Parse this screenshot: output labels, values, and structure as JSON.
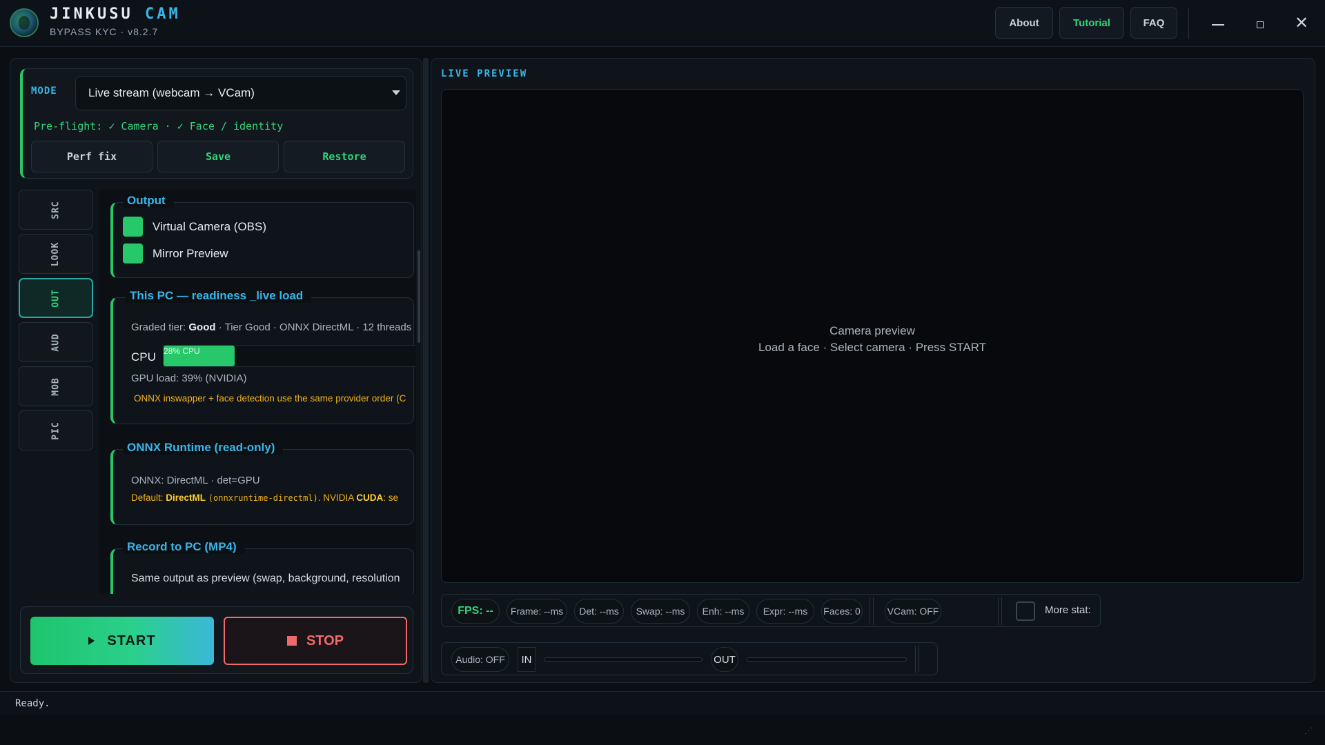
{
  "app": {
    "title_main": "JINKUSU",
    "title_accent": "CAM",
    "subtitle": "BYPASS KYC · v8.2.7"
  },
  "header": {
    "about": "About",
    "tutorial": "Tutorial",
    "faq": "FAQ",
    "close_glyph": "✕"
  },
  "mode": {
    "label": "MODE",
    "selected": "Live stream (webcam → VCam)",
    "preflight": "Pre-flight: ✓ Camera · ✓ Face / identity",
    "perf_fix": "Perf fix",
    "save": "Save",
    "restore": "Restore"
  },
  "side_tabs": [
    "SRC",
    "LOOK",
    "OUT",
    "AUD",
    "MOB",
    "PIC"
  ],
  "active_tab": "OUT",
  "output": {
    "title": "Output",
    "virtual_camera": "Virtual Camera (OBS)",
    "mirror_preview": "Mirror Preview"
  },
  "readiness": {
    "title": "This PC — readiness _live load",
    "tier_prefix": "Graded tier: ",
    "tier_value": "Good",
    "tier_suffix": " · Tier Good · ONNX DirectML · 12 threads",
    "cpu_label": "CPU",
    "cpu_text": "28% CPU",
    "cpu_percent": 28,
    "gpu_load": "GPU load: 39% (NVIDIA)",
    "warning": "ONNX inswapper + face detection use the same provider order (C"
  },
  "onnx": {
    "title": "ONNX Runtime (read-only)",
    "status": "ONNX: DirectML · det=GPU",
    "default_prefix": "Default: ",
    "default_provider": "DirectML",
    "package": "(onnxruntime-directml)",
    "nvidia_text": ". NVIDIA ",
    "cuda": "CUDA",
    "tail": ": se"
  },
  "record": {
    "title": "Record to PC (MP4)",
    "desc": "Same output as preview (swap, background, resolution"
  },
  "actions": {
    "start": "START",
    "stop": "STOP"
  },
  "preview": {
    "label": "LIVE PREVIEW",
    "title": "Camera preview",
    "hint": "Load a face  ·  Select camera  ·  Press START"
  },
  "stats": {
    "fps": "FPS: --",
    "frame": "Frame: --ms",
    "det": "Det: --ms",
    "swap": "Swap: --ms",
    "enh": "Enh: --ms",
    "expr": "Expr: --ms",
    "faces": "Faces: 0",
    "vcam": "VCam: OFF",
    "more": "More stat:"
  },
  "audio": {
    "status": "Audio: OFF",
    "in": "IN",
    "out": "OUT"
  },
  "status_bar": {
    "text": "Ready."
  },
  "colors": {
    "accent_green": "#27c86a",
    "accent_blue": "#38b6e8",
    "warning": "#f2b21b",
    "stop_red": "#ef6b6b",
    "background": "#0b0f14"
  }
}
